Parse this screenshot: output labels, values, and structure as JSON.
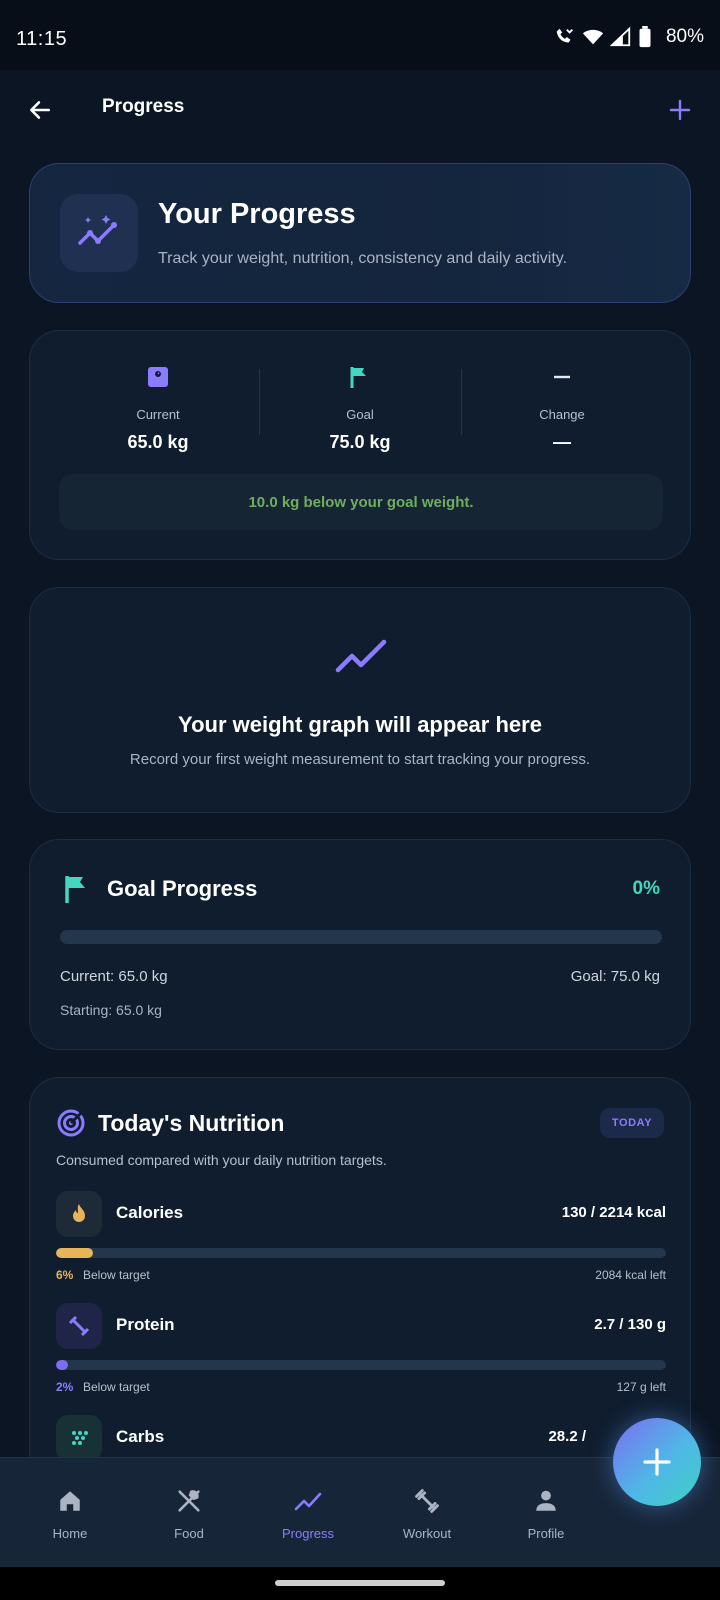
{
  "status_bar": {
    "time": "11:15",
    "battery": "80%"
  },
  "app_bar": {
    "title": "Progress"
  },
  "hero": {
    "title": "Your Progress",
    "subtitle": "Track your weight, nutrition, consistency and daily activity."
  },
  "stats": {
    "current": {
      "label": "Current",
      "value": "65.0 kg"
    },
    "goal": {
      "label": "Goal",
      "value": "75.0 kg"
    },
    "change": {
      "label": "Change",
      "value": "—"
    },
    "note": "10.0 kg below your goal weight."
  },
  "graph_placeholder": {
    "title": "Your weight graph will appear here",
    "subtitle": "Record your first weight measurement to start tracking your progress."
  },
  "goal_progress": {
    "title": "Goal Progress",
    "percent": "0%",
    "progress_fraction": 0,
    "current": "Current: 65.0 kg",
    "goal": "Goal: 75.0 kg",
    "starting": "Starting: 65.0 kg"
  },
  "nutrition": {
    "title": "Today's Nutrition",
    "badge": "TODAY",
    "subtitle": "Consumed compared with your daily nutrition targets.",
    "macros": [
      {
        "name": "Calories",
        "value": "130 / 2214 kcal",
        "pct": "6%",
        "status": "Below target",
        "left": "2084 kcal left",
        "color": "#e6b45a",
        "fraction": 0.06
      },
      {
        "name": "Protein",
        "value": "2.7 / 130 g",
        "pct": "2%",
        "status": "Below target",
        "left": "127 g left",
        "color": "#7c6df2",
        "fraction": 0.02
      },
      {
        "name": "Carbs",
        "value": "28.2 /",
        "color": "#43d6c0"
      }
    ]
  },
  "bottom_nav": {
    "items": [
      {
        "label": "Home"
      },
      {
        "label": "Food"
      },
      {
        "label": "Progress"
      },
      {
        "label": "Workout"
      },
      {
        "label": "Profile"
      }
    ]
  },
  "colors": {
    "accent": "#8b7cff",
    "teal": "#43d6c0",
    "success_text": "#6fae5e"
  }
}
